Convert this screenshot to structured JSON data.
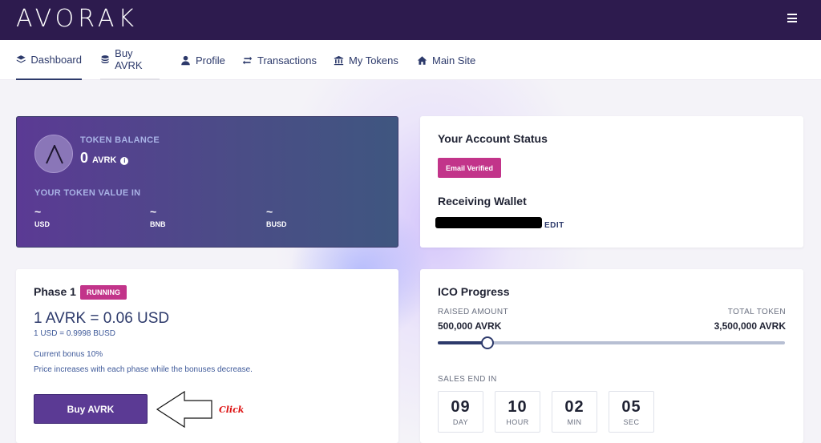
{
  "brand": {
    "logo_text": "AVORAK"
  },
  "nav": {
    "items": [
      {
        "label": "Dashboard",
        "icon": "layers-icon"
      },
      {
        "label": "Buy AVRK",
        "icon": "coins-icon"
      },
      {
        "label": "Profile",
        "icon": "user-icon"
      },
      {
        "label": "Transactions",
        "icon": "exchange-icon"
      },
      {
        "label": "My Tokens",
        "icon": "bank-icon"
      },
      {
        "label": "Main Site",
        "icon": "home-icon"
      }
    ]
  },
  "balance": {
    "label": "TOKEN BALANCE",
    "amount": "0",
    "unit": "AVRK",
    "info_icon": "i",
    "value_label": "YOUR TOKEN VALUE IN",
    "values": [
      {
        "value": "~",
        "currency": "USD"
      },
      {
        "value": "~",
        "currency": "BNB"
      },
      {
        "value": "~",
        "currency": "BUSD"
      }
    ]
  },
  "account": {
    "title": "Your Account Status",
    "email_badge": "Email Verified",
    "wallet_title": "Receiving Wallet",
    "edit_label": "EDIT"
  },
  "phase": {
    "title": "Phase 1",
    "status_badge": "RUNNING",
    "rate": "1 AVRK = 0.06 USD",
    "conversion": "1 USD = 0.9998 BUSD",
    "bonus": "Current bonus 10%",
    "note": "Price increases with each phase while the bonuses decrease.",
    "buy_label": "Buy AVRK",
    "annotation": "Click"
  },
  "ico": {
    "title": "ICO Progress",
    "raised_label": "RAISED AMOUNT",
    "raised_value": "500,000 AVRK",
    "total_label": "TOTAL TOKEN",
    "total_value": "3,500,000 AVRK",
    "progress_fraction": 0.143,
    "sales_end_label": "SALES END IN",
    "countdown": [
      {
        "value": "09",
        "unit": "DAY"
      },
      {
        "value": "10",
        "unit": "HOUR"
      },
      {
        "value": "02",
        "unit": "MIN"
      },
      {
        "value": "05",
        "unit": "SEC"
      }
    ]
  },
  "colors": {
    "header_bg": "#2d1b4e",
    "accent_purple": "#5b3a94",
    "badge_pink": "#c2348a",
    "nav_text": "#2d3a6b"
  }
}
